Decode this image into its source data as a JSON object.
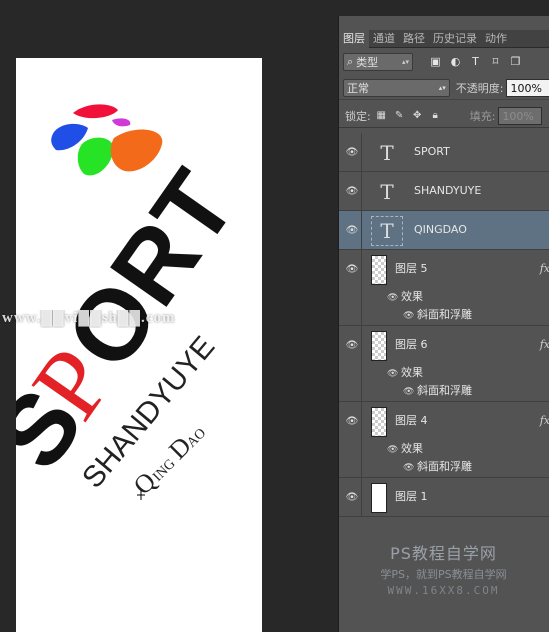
{
  "tabs": [
    "图层",
    "通道",
    "路径",
    "历史记录",
    "动作"
  ],
  "filter": {
    "kind": "类型"
  },
  "blend": {
    "mode": "正常",
    "opacity_label": "不透明度:",
    "opacity_value": "100%"
  },
  "lock": {
    "label": "锁定:",
    "fill_label": "填充:",
    "fill_value": "100%"
  },
  "layers": [
    {
      "name": "SPORT",
      "type": "text"
    },
    {
      "name": "SHANDYUYE",
      "type": "text"
    },
    {
      "name": "QINGDAO",
      "type": "text",
      "selected": true
    },
    {
      "name": "图层 5",
      "fx": "fx",
      "effects_label": "效果",
      "effect": "斜面和浮雕"
    },
    {
      "name": "图层 6",
      "fx": "fx",
      "effects_label": "效果",
      "effect": "斜面和浮雕"
    },
    {
      "name": "图层 4",
      "fx": "fx",
      "effects_label": "效果",
      "effect": "斜面和浮雕"
    },
    {
      "name": "图层 1",
      "type": "pixel"
    }
  ],
  "canvas": {
    "text_sport_S": "S",
    "text_sport_P": "P",
    "text_sport_ORT": "ORT",
    "text_shandyuye": "SHANDYUYE",
    "text_qingdao_Q": "Q",
    "text_qingdao_ING": "ING",
    "text_qingdao_D": "D",
    "text_qingdao_AO": "AO",
    "watermark": "www.██vi██sh██.com"
  },
  "watermark_right": {
    "title": "PS教程自学网",
    "subtitle": "学PS，就到PS教程自学网",
    "url": "WWW.16XX8.COM"
  },
  "colors": {
    "panel_bg": "#535353",
    "selected_row": "#5f7283",
    "sport_red": "#e32227"
  }
}
